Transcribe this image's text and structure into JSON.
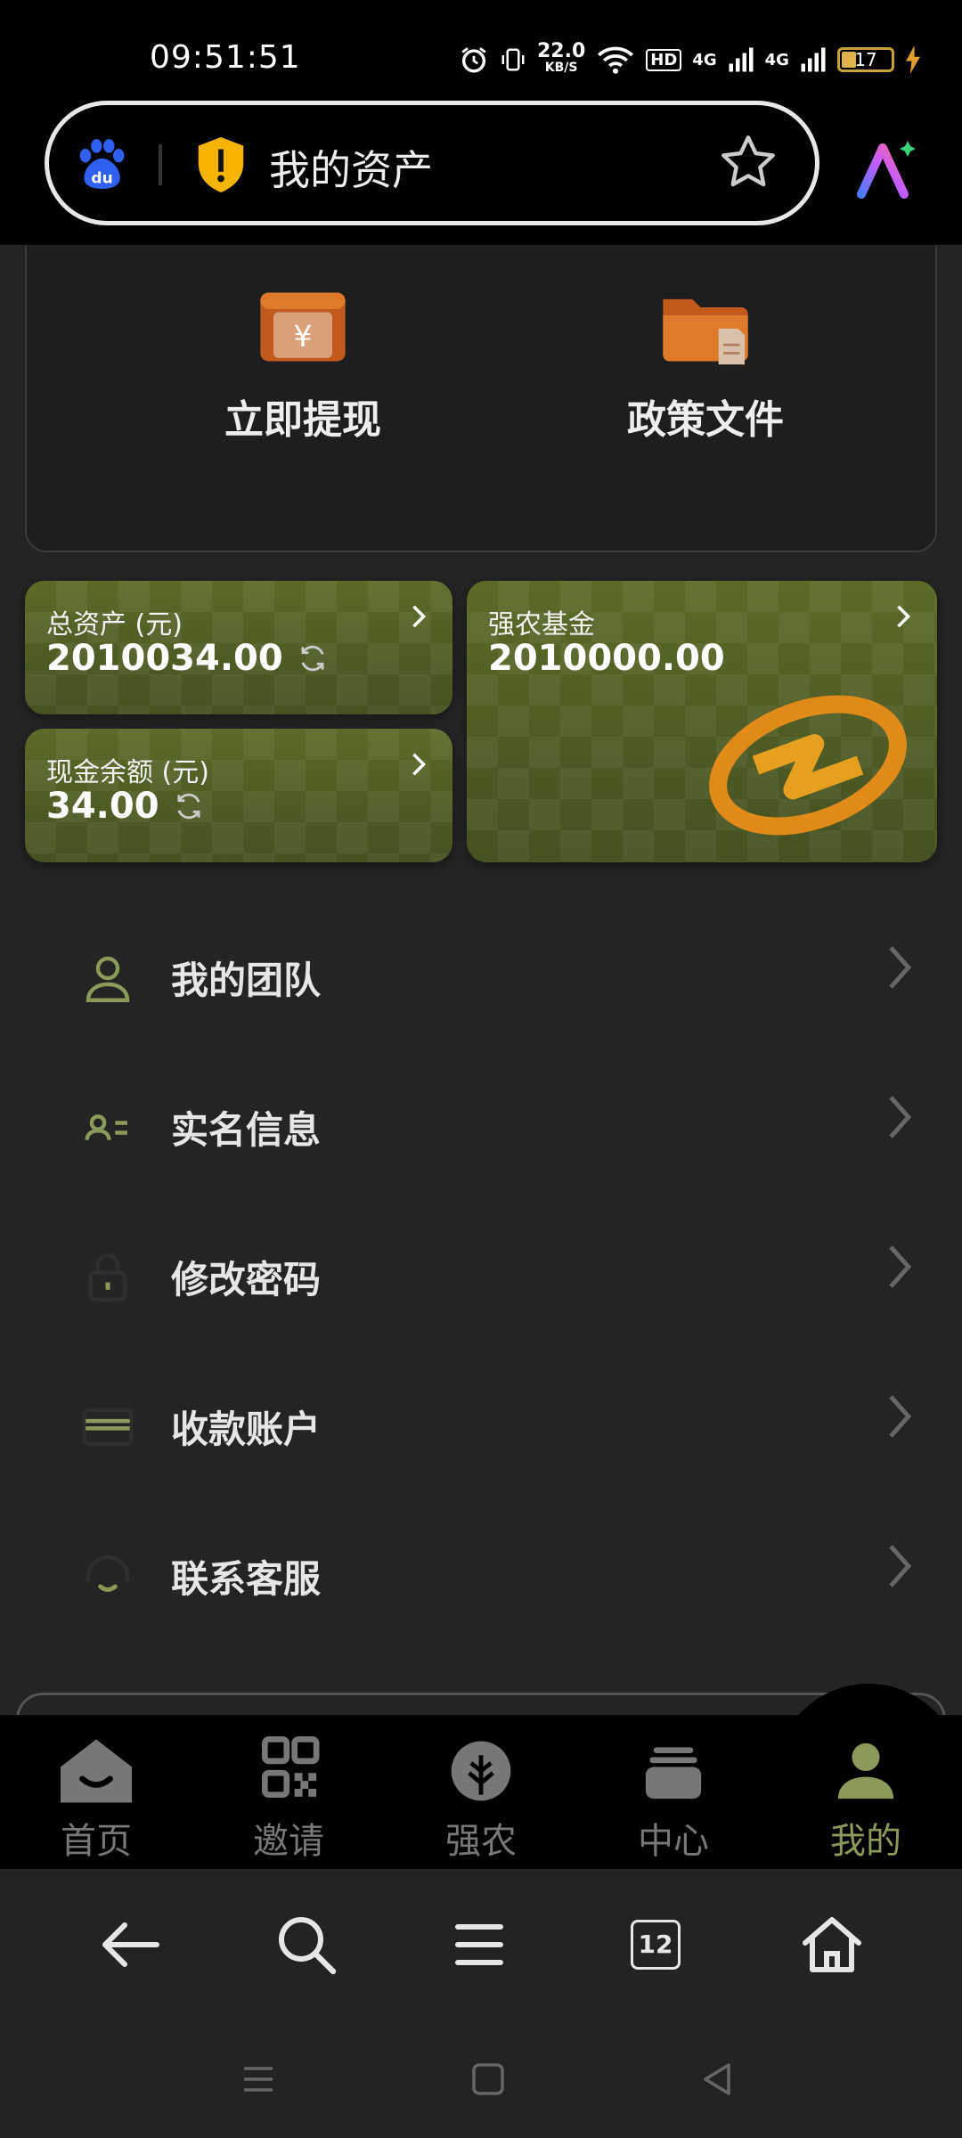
{
  "status_bar": {
    "time": "09:51:51",
    "network_speed": "22.0",
    "network_speed_unit": "KB/S",
    "hd_label": "HD",
    "signal_1": "4G",
    "signal_2": "4G",
    "battery": "17"
  },
  "browser": {
    "page_title": "我的资产",
    "tab_count": "12"
  },
  "quick_actions": [
    {
      "label": "立即提现",
      "icon": "wallet-yuan-icon"
    },
    {
      "label": "政策文件",
      "icon": "folder-document-icon"
    }
  ],
  "assets": {
    "total": {
      "title": "总资产 (元)",
      "value": "2010034.00"
    },
    "cash": {
      "title": "现金余额 (元)",
      "value": "34.00"
    },
    "fund": {
      "title": "强农基金",
      "value": "2010000.00"
    }
  },
  "menu": [
    {
      "label": "我的团队",
      "icon": "person-icon"
    },
    {
      "label": "实名信息",
      "icon": "id-card-icon"
    },
    {
      "label": "修改密码",
      "icon": "lock-icon"
    },
    {
      "label": "收款账户",
      "icon": "bank-card-icon"
    },
    {
      "label": "联系客服",
      "icon": "headset-icon"
    }
  ],
  "tabs": [
    {
      "label": "首页",
      "icon": "home-icon"
    },
    {
      "label": "邀请",
      "icon": "qr-code-icon"
    },
    {
      "label": "强农",
      "icon": "wheat-icon"
    },
    {
      "label": "中心",
      "icon": "stack-icon"
    },
    {
      "label": "我的",
      "icon": "user-icon",
      "active": true
    }
  ],
  "colors": {
    "accent": "#8b9a5a",
    "card_green": "#4d5820",
    "background": "#242424",
    "orange": "#e07a2a"
  }
}
